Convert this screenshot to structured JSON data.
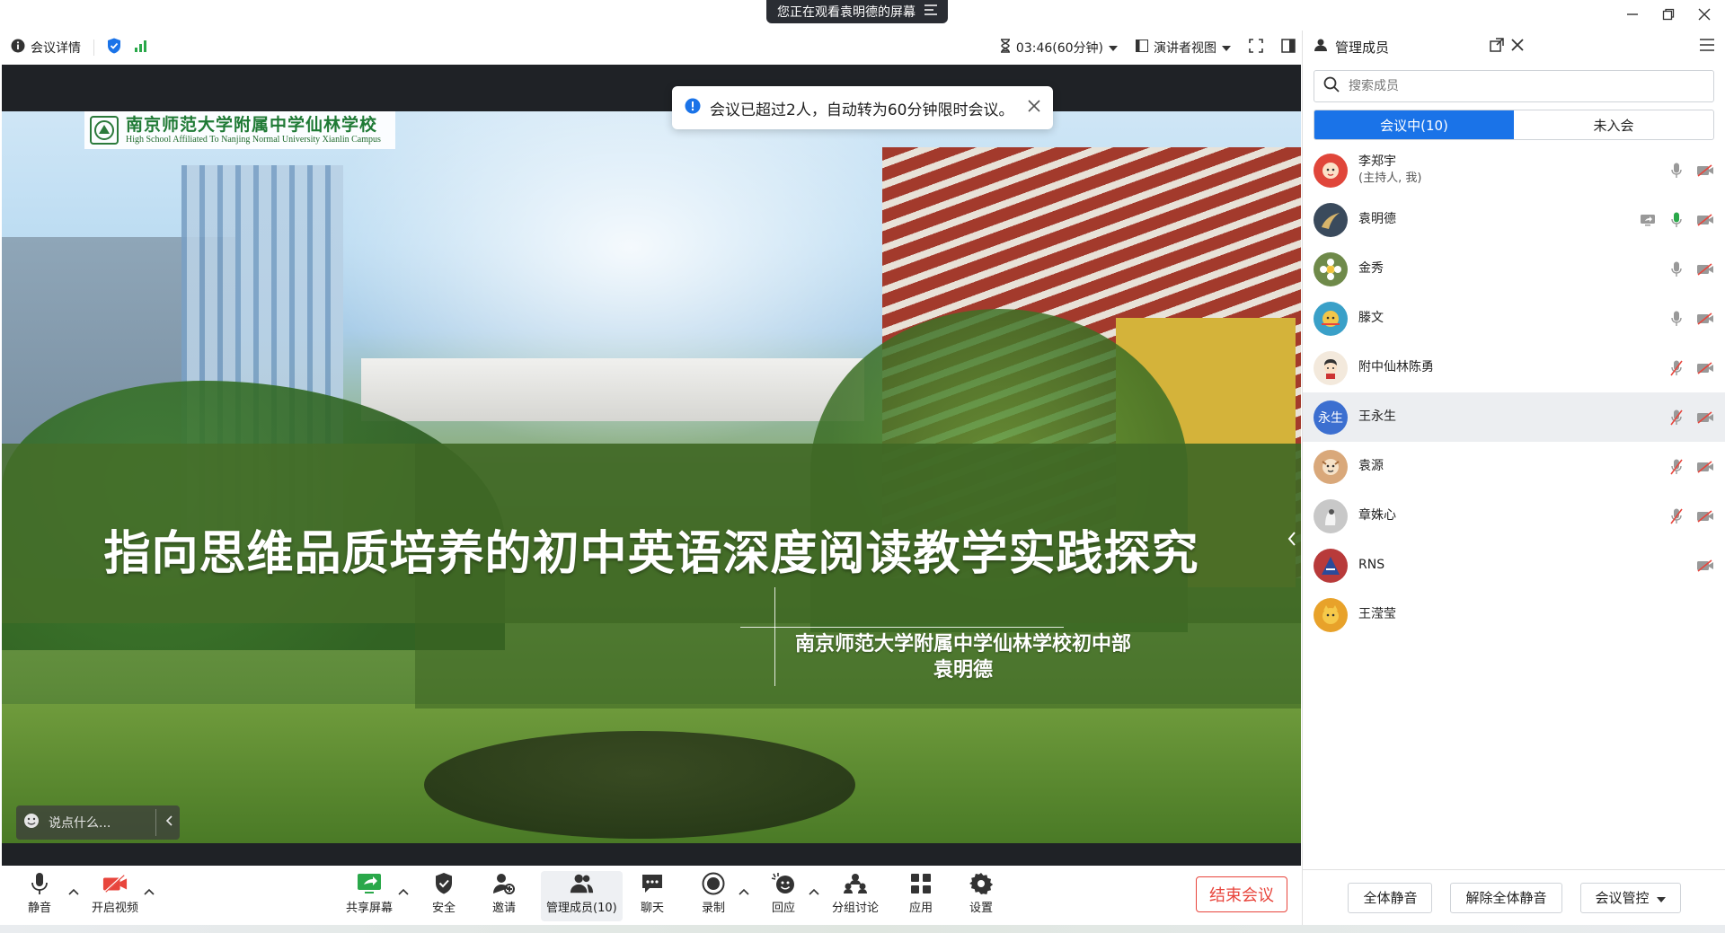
{
  "title_bar": {
    "sharing_notice": "您正在观看袁明德的屏幕"
  },
  "top_bar": {
    "meeting_info": "会议详情",
    "timer": "03:46(60分钟)",
    "view_mode": "演讲者视图"
  },
  "toast": {
    "message": "会议已超过2人，自动转为60分钟限时会议。"
  },
  "slide": {
    "logo_cn": "南京师范大学附属中学仙林学校",
    "logo_en": "High School Affiliated To Nanjing Normal University Xianlin Campus",
    "title": "指向思维品质培养的初中英语深度阅读教学实践探究",
    "subtitle_line1": "南京师范大学附属中学仙林学校初中部",
    "subtitle_line2": "袁明德"
  },
  "chat": {
    "placeholder": "说点什么..."
  },
  "toolbar": {
    "mute": "静音",
    "video": "开启视频",
    "share": "共享屏幕",
    "security": "安全",
    "invite": "邀请",
    "members": "管理成员(10)",
    "chat": "聊天",
    "record": "录制",
    "reaction": "回应",
    "breakout": "分组讨论",
    "apps": "应用",
    "settings": "设置",
    "end": "结束会议"
  },
  "panel": {
    "title": "管理成员",
    "search_placeholder": "搜索成员",
    "tab_in": "会议中(10)",
    "tab_out": "未入会",
    "members": [
      {
        "name": "李郑宇",
        "sub": "(主持人, 我)",
        "avatar_color": "#e0463a",
        "initials": ""
      },
      {
        "name": "袁明德",
        "sub": "",
        "avatar_color": "#3a4a5c",
        "initials": ""
      },
      {
        "name": "金秀",
        "sub": "",
        "avatar_color": "#6f8a4a",
        "initials": ""
      },
      {
        "name": "滕文",
        "sub": "",
        "avatar_color": "#3aa0c8",
        "initials": ""
      },
      {
        "name": "附中仙林陈勇",
        "sub": "",
        "avatar_color": "#f3e9dc",
        "initials": ""
      },
      {
        "name": "王永生",
        "sub": "",
        "avatar_color": "#3c6fd0",
        "initials": "永生"
      },
      {
        "name": "袁源",
        "sub": "",
        "avatar_color": "#d9a87a",
        "initials": ""
      },
      {
        "name": "章姝心",
        "sub": "",
        "avatar_color": "#c8c8c8",
        "initials": ""
      },
      {
        "name": "RNS",
        "sub": "",
        "avatar_color": "#b83a3a",
        "initials": ""
      },
      {
        "name": "王滢莹",
        "sub": "",
        "avatar_color": "#e8a22a",
        "initials": ""
      }
    ],
    "mute_all": "全体静音",
    "unmute_all": "解除全体静音",
    "control": "会议管控"
  },
  "colors": {
    "accent": "#1a73e8",
    "danger": "#e8453c",
    "mic_active": "#2aa84a"
  }
}
